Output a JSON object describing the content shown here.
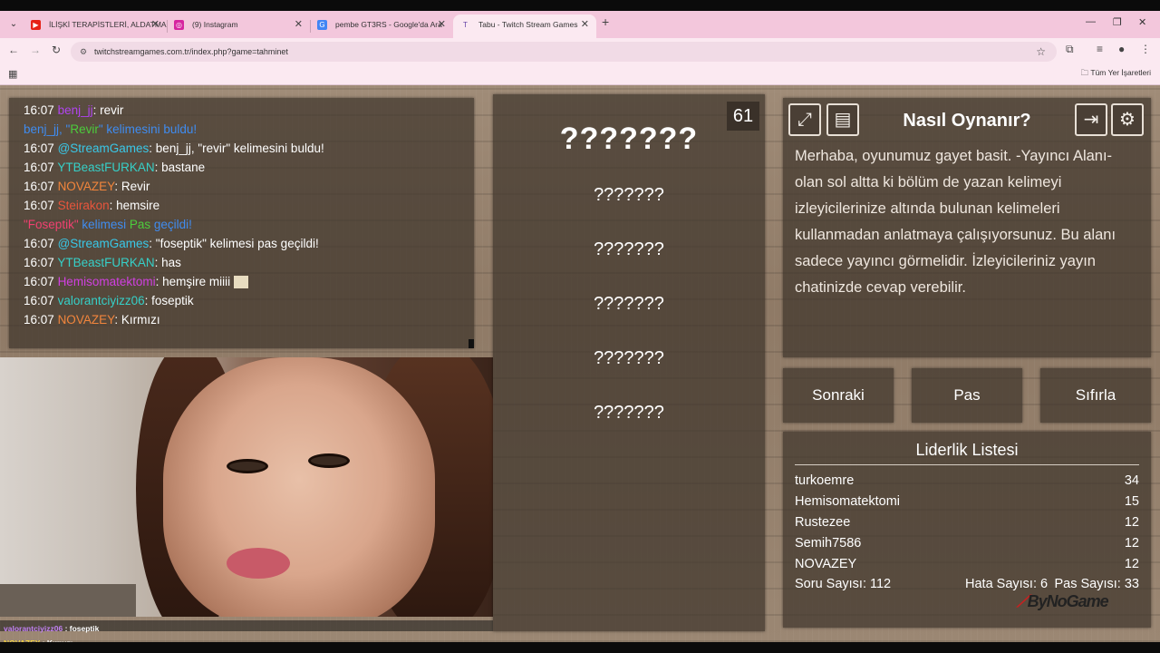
{
  "browser": {
    "tabs": [
      {
        "title": "İLİŞKİ TERAPİSTLERİ, ALDATMA",
        "favicon": "youtube-icon"
      },
      {
        "title": "(9) Instagram",
        "favicon": "instagram-icon"
      },
      {
        "title": "pembe GT3RS - Google'da Ara",
        "favicon": "google-icon"
      },
      {
        "title": "Tabu - Twitch Stream Games",
        "favicon": "twitch-icon"
      }
    ],
    "url": "twitchstreamgames.com.tr/index.php?game=tahminet",
    "bookmarks_all": "Tüm Yer İşaretleri"
  },
  "chat": [
    {
      "time": "16:07",
      "user": "benj_jj",
      "msg": ": revir"
    },
    {
      "plain": "benj_jj, \"Revir\" kelimesini buldu!"
    },
    {
      "time": "16:07",
      "user": "@StreamGames",
      "msg": ": benj_jj, \"revir\" kelimesini buldu!"
    },
    {
      "time": "16:07",
      "user": "YTBeastFURKAN",
      "msg": ": bastane"
    },
    {
      "time": "16:07",
      "user": "NOVAZEY",
      "msg": ": Revir"
    },
    {
      "time": "16:07",
      "user": "Steirakon",
      "msg": ": hemsire"
    },
    {
      "plain": "\"Foseptik\" kelimesi Pas geçildi!"
    },
    {
      "time": "16:07",
      "user": "@StreamGames",
      "msg": ": \"foseptik\" kelimesi pas geçildi!"
    },
    {
      "time": "16:07",
      "user": "YTBeastFURKAN",
      "msg": ": has"
    },
    {
      "time": "16:07",
      "user": "Hemisomatektomi",
      "msg": ": hemşire miiii"
    },
    {
      "time": "16:07",
      "user": "valorantciyizz06",
      "msg": ": foseptik"
    },
    {
      "time": "16:07",
      "user": "NOVAZEY",
      "msg": ": Kırmızı"
    }
  ],
  "chat_parts": {
    "line2_a": "benj_jj, \"",
    "line2_b": "Revir",
    "line2_c": "\" kelimesini buldu!",
    "line7_a": "\"Foseptik\"",
    "line7_b": " kelimesi ",
    "line7_c": "Pas",
    "line7_d": " geçildi!"
  },
  "overlay": [
    {
      "user": "valorantciyizz06",
      "msg": " : foseptik"
    },
    {
      "user": "NOVAZEY",
      "msg": " : Kırmızı"
    }
  ],
  "game": {
    "timer": "61",
    "main_word": "???????",
    "taboo_words": [
      "???????",
      "???????",
      "???????",
      "???????",
      "???????"
    ]
  },
  "howto": {
    "title": "Nasıl Oynanır?",
    "text": "Merhaba, oyunumuz gayet basit. -Yayıncı Alanı- olan sol altta ki bölüm de yazan kelimeyi izleyicilerinize altında bulunan kelimeleri kullanmadan anlatmaya çalışıyorsunuz. Bu alanı sadece yayıncı görmelidir. İzleyicileriniz yayın chatinizde cevap verebilir."
  },
  "buttons": {
    "next": "Sonraki",
    "pass": "Pas",
    "reset": "Sıfırla"
  },
  "leaderboard": {
    "title": "Liderlik Listesi",
    "rows": [
      {
        "name": "turkoemre",
        "score": "34"
      },
      {
        "name": "Hemisomatektomi",
        "score": "15"
      },
      {
        "name": "Rustezee",
        "score": "12"
      },
      {
        "name": "Semih7586",
        "score": "12"
      },
      {
        "name": "NOVAZEY",
        "score": "12"
      }
    ],
    "question_count": "Soru Sayısı: 112",
    "error_count": "Hata Sayısı: 6",
    "pass_count": "Pas Sayısı: 33",
    "brand": "ByNoGame"
  },
  "colors": {
    "wood": "#9b8773",
    "panel": "#3e342b",
    "tabstrip": "#f3c7dc"
  }
}
